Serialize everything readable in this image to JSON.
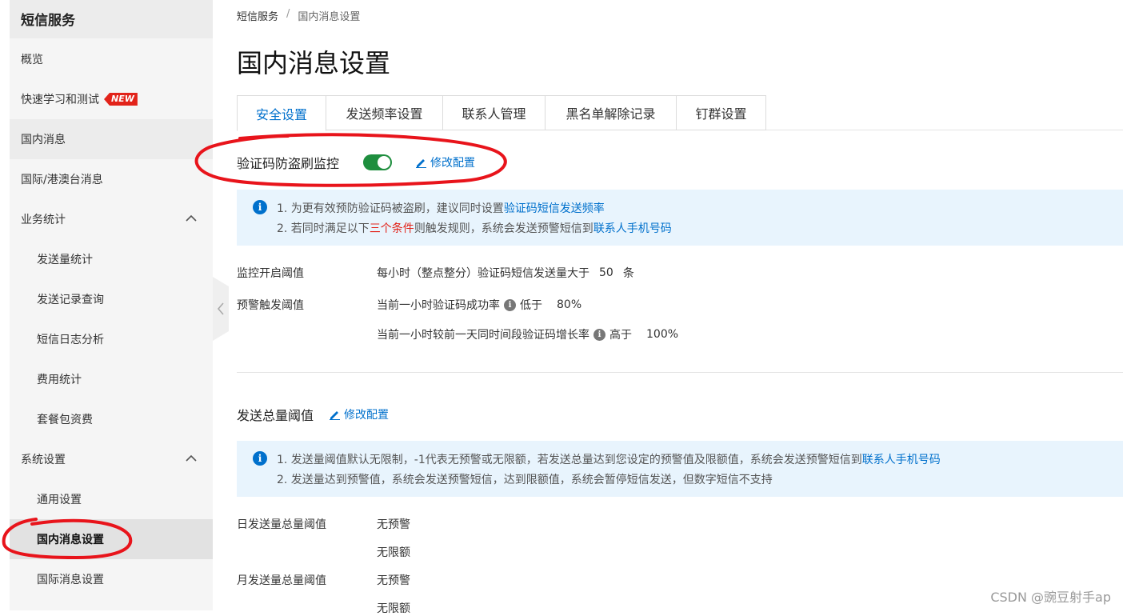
{
  "sidebar": {
    "title": "短信服务",
    "items": [
      {
        "label": "概览"
      },
      {
        "label": "快速学习和测试",
        "badge": "NEW"
      },
      {
        "label": "国内消息"
      },
      {
        "label": "国际/港澳台消息"
      },
      {
        "label": "业务统计"
      },
      {
        "label": "发送量统计"
      },
      {
        "label": "发送记录查询"
      },
      {
        "label": "短信日志分析"
      },
      {
        "label": "费用统计"
      },
      {
        "label": "套餐包资费"
      },
      {
        "label": "系统设置"
      },
      {
        "label": "通用设置"
      },
      {
        "label": "国内消息设置"
      },
      {
        "label": "国际消息设置"
      }
    ]
  },
  "breadcrumb": {
    "root": "短信服务",
    "separator": "/",
    "current": "国内消息设置"
  },
  "page_title": "国内消息设置",
  "tabs": [
    {
      "label": "安全设置",
      "active": true
    },
    {
      "label": "发送频率设置"
    },
    {
      "label": "联系人管理"
    },
    {
      "label": "黑名单解除记录"
    },
    {
      "label": "钉群设置"
    }
  ],
  "captcha_monitor": {
    "title": "验证码防盗刷监控",
    "enabled": true,
    "edit_label": "修改配置",
    "notice": {
      "line1_prefix": "1. 为更有效预防验证码被盗刷，建议同时设置",
      "line1_link": "验证码短信发送频率",
      "line2_prefix": "2. 若同时满足以下",
      "line2_highlight": "三个条件",
      "line2_mid": "则触发规则，系统会发送预警短信到",
      "line2_link": "联系人手机号码"
    },
    "monitor_label": "监控开启阈值",
    "monitor_text": "每小时（整点整分）验证码短信发送量大于",
    "monitor_value": "50",
    "monitor_unit": "条",
    "alert_label": "预警触发阈值",
    "alert1_text": "当前一小时验证码成功率",
    "alert1_cmp": "低于",
    "alert1_value": "80%",
    "alert2_text": "当前一小时较前一天同时间段验证码增长率",
    "alert2_cmp": "高于",
    "alert2_value": "100%"
  },
  "total_threshold": {
    "title": "发送总量阈值",
    "edit_label": "修改配置",
    "notice": {
      "line1_prefix": "1. 发送量阈值默认无限制，-1代表无预警或无限额，若发送总量达到您设定的预警值及限额值，系统会发送预警短信到",
      "line1_link": "联系人手机号码",
      "line2": "2. 发送量达到预警值，系统会发送预警短信，达到限额值，系统会暂停短信发送，但数字短信不支持"
    },
    "daily_label": "日发送量总量阈值",
    "daily_warn": "无预警",
    "daily_limit": "无限额",
    "monthly_label": "月发送量总量阈值",
    "monthly_warn": "无预警",
    "monthly_limit": "无限额"
  },
  "watermark": "CSDN @豌豆射手ap",
  "colors": {
    "accent": "#0070cc",
    "toggle_on": "#1e8e3e",
    "badge": "#e2231a",
    "annotation": "#e8141b",
    "notice_bg": "#e8f4fd"
  }
}
